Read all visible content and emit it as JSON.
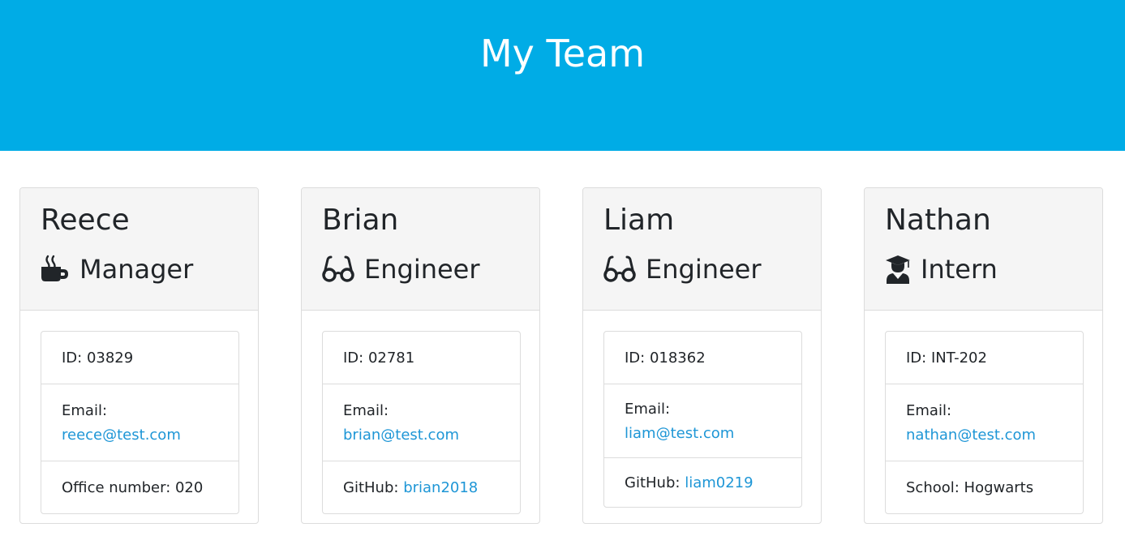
{
  "header": {
    "title": "My Team"
  },
  "colors": {
    "header_bg": "#00ace6",
    "link": "#1e96d6",
    "card_header_bg": "#f5f5f5"
  },
  "team": [
    {
      "name": "Reece",
      "role": "Manager",
      "icon": "mug-icon",
      "id_text": "ID: 03829",
      "email_label": "Email:",
      "email": "reece@test.com",
      "extra_label": "Office number: 020",
      "extra_link": ""
    },
    {
      "name": "Brian",
      "role": "Engineer",
      "icon": "glasses-icon",
      "id_text": "ID: 02781",
      "email_label": "Email:",
      "email": "brian@test.com",
      "extra_label": "GitHub:",
      "extra_link": "brian2018"
    },
    {
      "name": "Liam",
      "role": "Engineer",
      "icon": "glasses-icon",
      "id_text": "ID: 018362",
      "email_label": "Email:",
      "email": "liam@test.com",
      "extra_label": "GitHub:",
      "extra_link": "liam0219"
    },
    {
      "name": "Nathan",
      "role": "Intern",
      "icon": "graduate-icon",
      "id_text": "ID: INT-202",
      "email_label": "Email:",
      "email": "nathan@test.com",
      "extra_label": "School: Hogwarts",
      "extra_link": ""
    }
  ]
}
